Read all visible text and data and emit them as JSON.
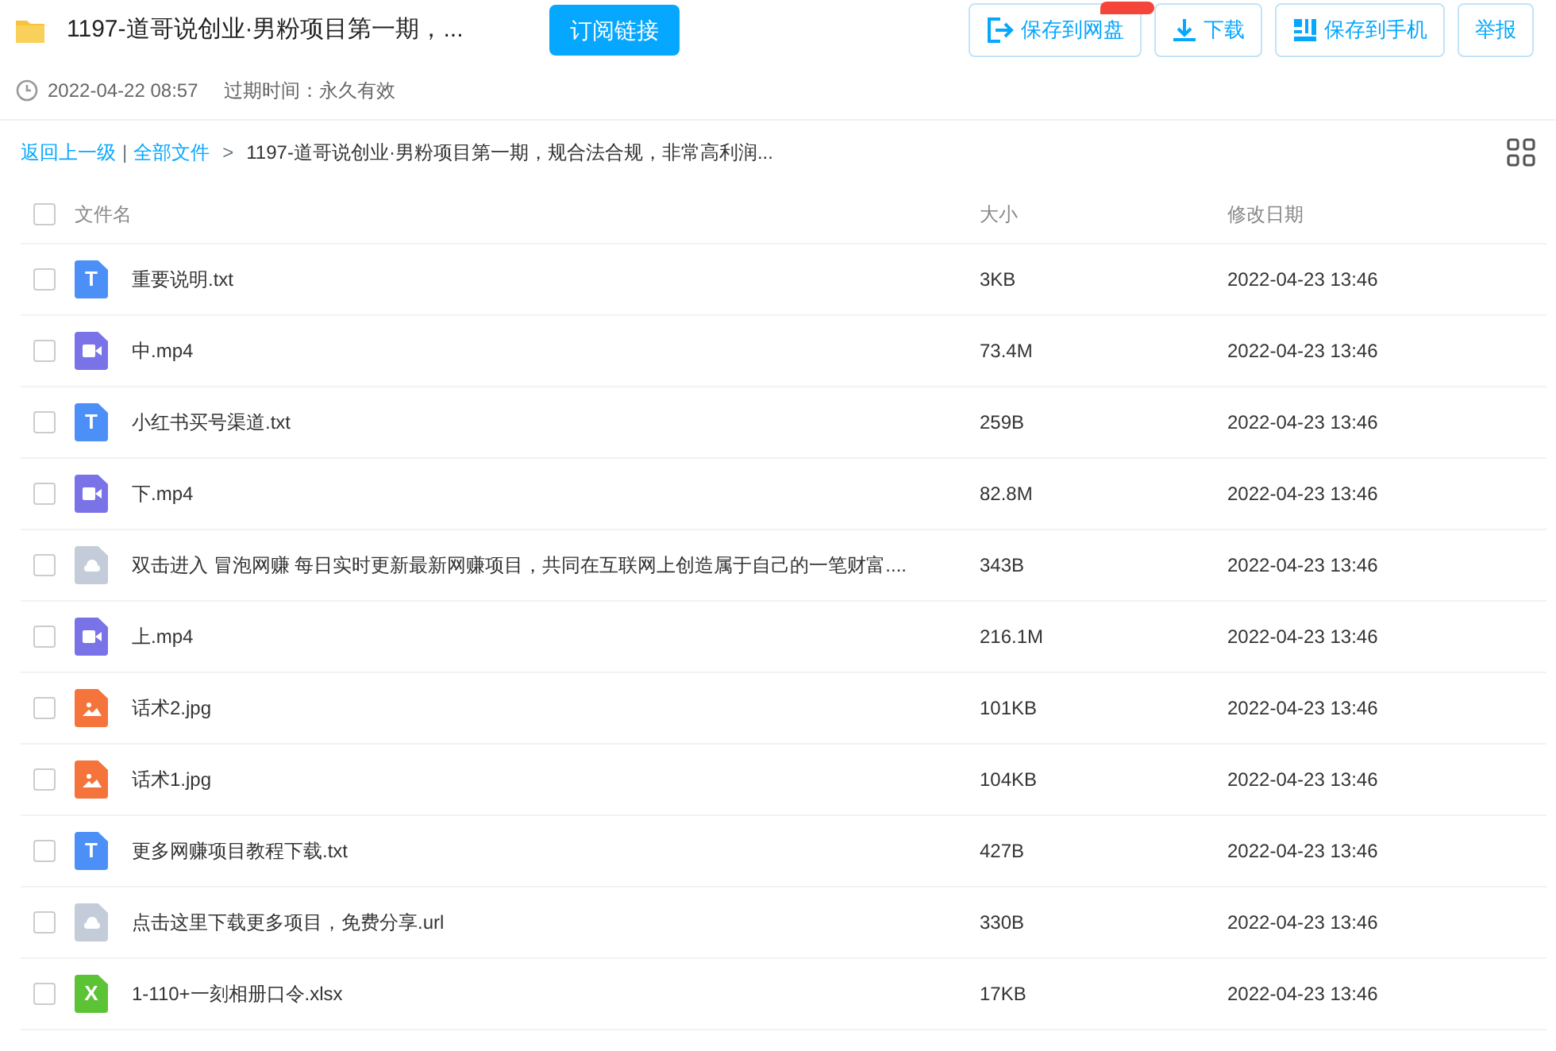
{
  "header": {
    "title": "1197-道哥说创业·男粉项目第一期，...",
    "subscribe_button": "订阅链接",
    "actions": [
      {
        "kind": "save",
        "label": "保存到网盘",
        "promo_badge": true
      },
      {
        "kind": "download",
        "label": "下载"
      },
      {
        "kind": "phone",
        "label": "保存到手机"
      },
      {
        "kind": "report",
        "label": "举报"
      }
    ]
  },
  "meta": {
    "created": "2022-04-22 08:57",
    "expiry": "过期时间：永久有效"
  },
  "breadcrumb": {
    "back": "返回上一级",
    "all": "全部文件",
    "divider": "|",
    "separator": ">",
    "current": "1197-道哥说创业·男粉项目第一期，规合法合规，非常高利润..."
  },
  "table": {
    "columns": [
      "文件名",
      "大小",
      "修改日期"
    ],
    "header_checked": false,
    "rows": [
      {
        "kind": "text",
        "icon_text": "T",
        "name": "重要说明.txt",
        "size": "3KB",
        "date": "2022-04-23 13:46",
        "checked": false
      },
      {
        "kind": "video",
        "name": "中.mp4",
        "size": "73.4M",
        "date": "2022-04-23 13:46",
        "checked": false
      },
      {
        "kind": "text",
        "icon_text": "T",
        "name": "小红书买号渠道.txt",
        "size": "259B",
        "date": "2022-04-23 13:46",
        "checked": false
      },
      {
        "kind": "video",
        "name": "下.mp4",
        "size": "82.8M",
        "date": "2022-04-23 13:46",
        "checked": false
      },
      {
        "kind": "link",
        "name": "双击进入 冒泡网赚 每日实时更新最新网赚项目，共同在互联网上创造属于自己的一笔财富....",
        "size": "343B",
        "date": "2022-04-23 13:46",
        "checked": false
      },
      {
        "kind": "video",
        "name": "上.mp4",
        "size": "216.1M",
        "date": "2022-04-23 13:46",
        "checked": false
      },
      {
        "kind": "image",
        "name": "话术2.jpg",
        "size": "101KB",
        "date": "2022-04-23 13:46",
        "checked": false
      },
      {
        "kind": "image",
        "name": "话术1.jpg",
        "size": "104KB",
        "date": "2022-04-23 13:46",
        "checked": false
      },
      {
        "kind": "text",
        "icon_text": "T",
        "name": "更多网赚项目教程下载.txt",
        "size": "427B",
        "date": "2022-04-23 13:46",
        "checked": false
      },
      {
        "kind": "link",
        "name": "点击这里下载更多项目，免费分享.url",
        "size": "330B",
        "date": "2022-04-23 13:46",
        "checked": false
      },
      {
        "kind": "excel",
        "icon_text": "X",
        "name": "1-110+一刻相册口令.xlsx",
        "size": "17KB",
        "date": "2022-04-23 13:46",
        "checked": false
      }
    ]
  }
}
